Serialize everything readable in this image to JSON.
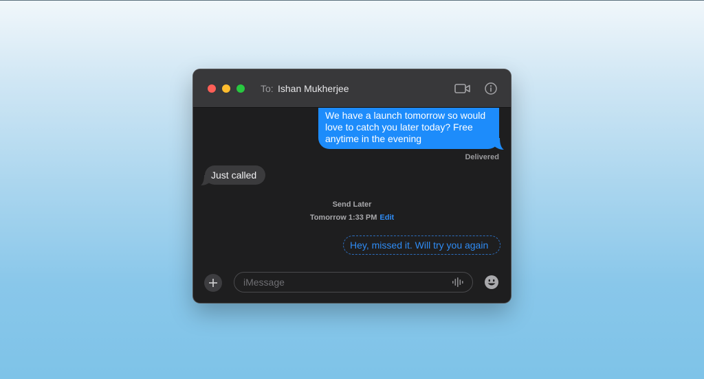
{
  "header": {
    "to_label": "To:",
    "recipient_name": "Ishan Mukherjee"
  },
  "icons": {
    "video": "video-camera-icon",
    "info": "info-icon",
    "add": "plus-icon",
    "audio": "waveform-icon",
    "emoji": "emoji-icon"
  },
  "messages": {
    "outgoing_1": "We have a launch tomorrow so would\nlove to catch you later today? Free\nanytime in the evening",
    "status_1": "Delivered",
    "incoming_1": "Just called",
    "send_later_label": "Send Later",
    "scheduled_time": "Tomorrow 1:33 PM",
    "edit_label": "Edit",
    "scheduled_message": "Hey, missed it. Will try you again"
  },
  "composer": {
    "placeholder": "iMessage"
  },
  "colors": {
    "outgoing_bubble": "#1d8cfb",
    "incoming_bubble": "#3b3b3d",
    "accent": "#2f8cf5"
  }
}
